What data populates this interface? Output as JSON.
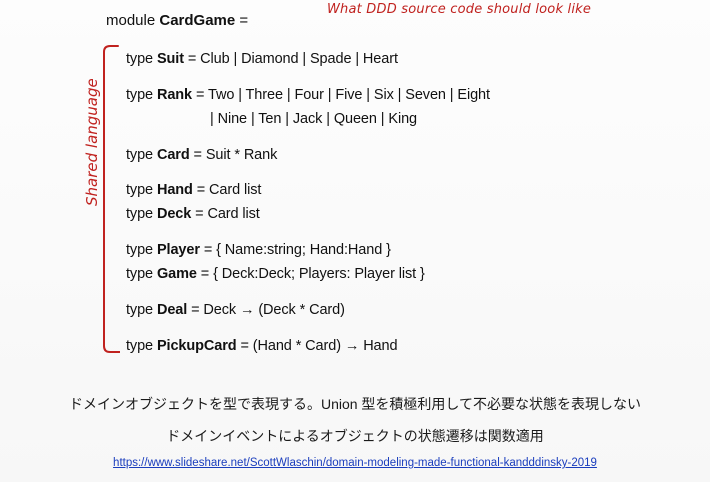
{
  "module": {
    "keyword": "module",
    "name": "CardGame",
    "equals": "="
  },
  "annotation": "What DDD source code should look like",
  "side_label": "Shared language",
  "code": [
    {
      "kw": "type",
      "name": "Suit",
      "def": "= Club | Diamond | Spade | Heart"
    },
    {
      "kw": "type",
      "name": "Rank",
      "def": "= Two | Three | Four | Five | Six | Seven | Eight"
    },
    {
      "kw": "",
      "name": "",
      "def": "| Nine | Ten | Jack | Queen | King"
    },
    {
      "kw": "type",
      "name": "Card",
      "def": "= Suit * Rank"
    },
    {
      "kw": "type",
      "name": "Hand",
      "def": "= Card list"
    },
    {
      "kw": "type",
      "name": "Deck",
      "def": "= Card list"
    },
    {
      "kw": "type",
      "name": "Player",
      "def": "= { Name:string;  Hand:Hand }"
    },
    {
      "kw": "type",
      "name": "Game",
      "def": "= { Deck:Deck;  Players: Player list }"
    },
    {
      "kw": "type",
      "name": "Deal",
      "def": "= Deck → (Deck * Card)"
    },
    {
      "kw": "type",
      "name": "PickupCard",
      "def": "= (Hand * Card) → Hand"
    }
  ],
  "captions": [
    "ドメインオブジェクトを型で表現する。Union 型を積極利用して不必要な状態を表現しない",
    "ドメインイベントによるオブジェクトの状態遷移は関数適用"
  ],
  "link": "https://www.slideshare.net/ScottWlaschin/domain-modeling-made-functional-kandddinsky-2019",
  "colors": {
    "annotation": "#c0221f",
    "link": "#1a3dbd"
  }
}
